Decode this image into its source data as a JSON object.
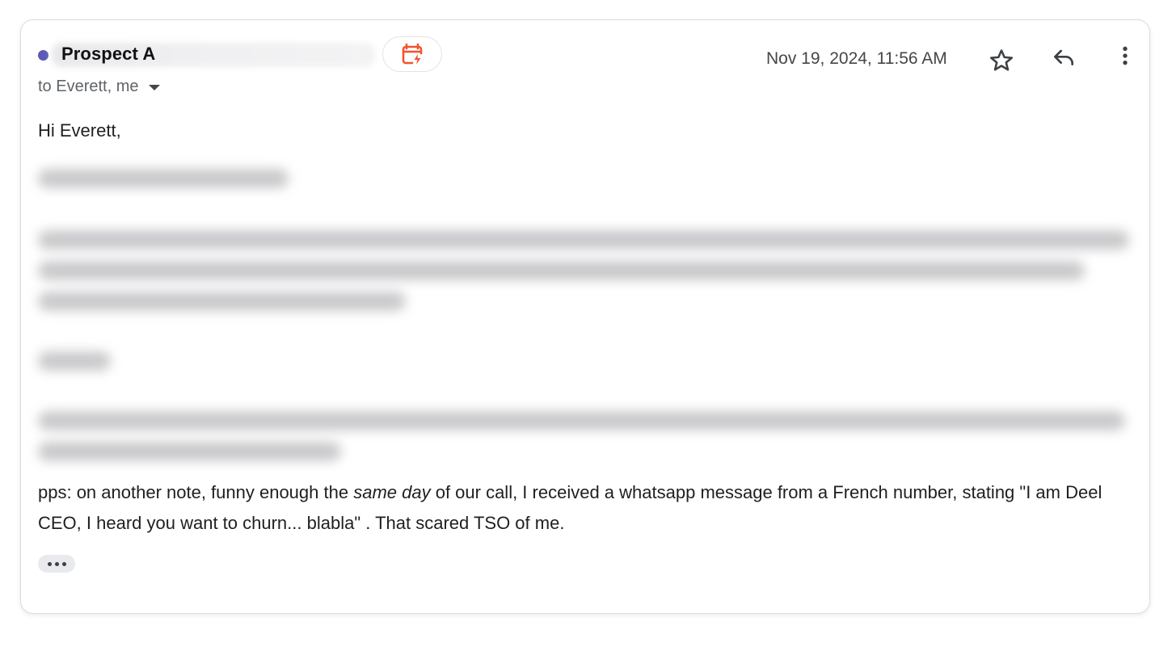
{
  "email": {
    "sender": {
      "name": "Prospect A"
    },
    "recipients": "to Everett, me",
    "date": "Nov 19, 2024, 11:56 AM",
    "actions": {
      "quick_action_icon": "calendar-bolt-icon",
      "star_icon": "star-icon",
      "reply_icon": "reply-icon",
      "more_icon": "more-vert-icon"
    },
    "body": {
      "greeting": "Hi Everett,",
      "pps_part1": "pps: on another note, funny enough the ",
      "pps_emphasis": "same day",
      "pps_part2": " of our call, I received a whatsapp message from a French number, stating \"I am Deel CEO, I heard you want to churn... blabla\" . That scared TSO of me."
    },
    "colors": {
      "unread_dot": "#5b5bb5",
      "quick_action_accent": "#f2542d",
      "text_primary": "#1f1f1f",
      "text_secondary": "#5f6368"
    }
  }
}
